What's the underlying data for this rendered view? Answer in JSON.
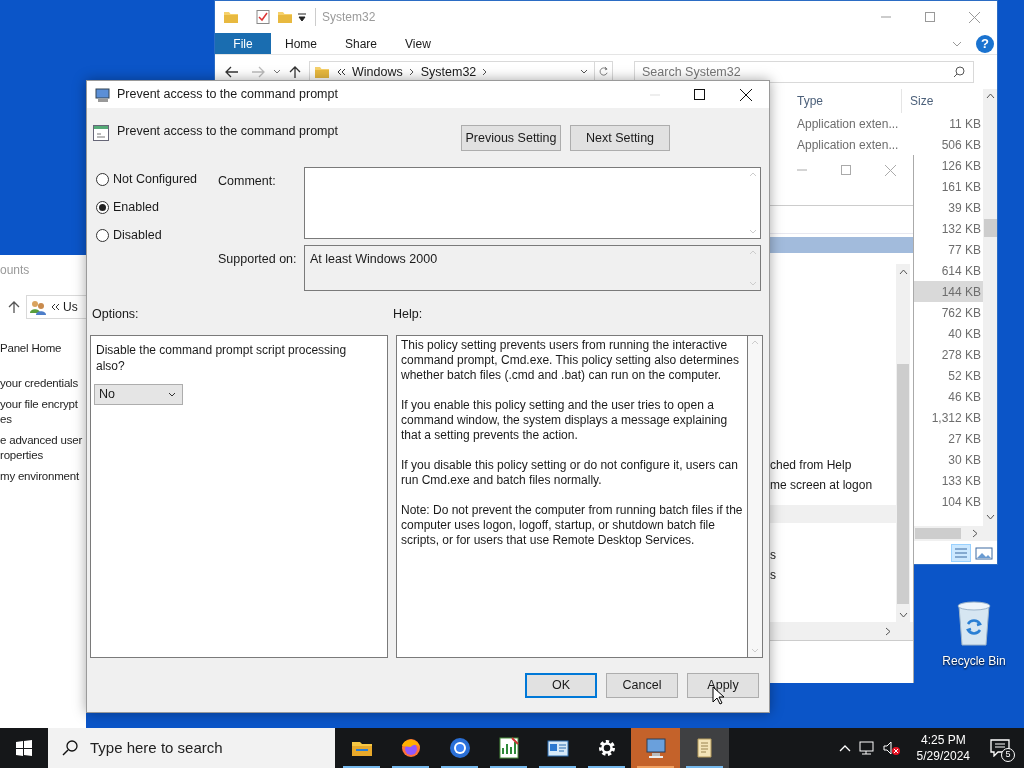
{
  "explorer": {
    "title": "System32",
    "ribbon_tabs": [
      {
        "label": "File",
        "kind": "file"
      },
      {
        "label": "Home",
        "kind": "tab"
      },
      {
        "label": "Share",
        "kind": "tab"
      },
      {
        "label": "View",
        "kind": "tab"
      }
    ],
    "help": "?",
    "address": [
      {
        "label": "Windows"
      },
      {
        "label": "System32"
      }
    ],
    "search": {
      "placeholder": "Search System32"
    },
    "columns": [
      "Type",
      "Size"
    ],
    "rows": [
      {
        "type": "Application exten...",
        "size": "11 KB",
        "selected": false
      },
      {
        "type": "Application exten...",
        "size": "506 KB",
        "selected": false
      },
      {
        "size": "126 KB",
        "selected": false
      },
      {
        "size": "161 KB",
        "selected": false
      },
      {
        "size": "39 KB",
        "selected": false
      },
      {
        "size": "132 KB",
        "selected": false
      },
      {
        "size": "77 KB",
        "selected": false
      },
      {
        "size": "614 KB",
        "selected": false
      },
      {
        "size": "144 KB",
        "selected": true
      },
      {
        "size": "762 KB",
        "selected": false
      },
      {
        "size": "40 KB",
        "selected": false
      },
      {
        "size": "278 KB",
        "selected": false
      },
      {
        "size": "52 KB",
        "selected": false
      },
      {
        "size": "46 KB",
        "selected": false
      },
      {
        "size": "1,312 KB",
        "selected": false
      },
      {
        "size": "27 KB",
        "selected": false
      },
      {
        "size": "30 KB",
        "selected": false
      },
      {
        "size": "133 KB",
        "selected": false
      },
      {
        "size": "104 KB",
        "selected": false
      }
    ]
  },
  "control_panel": {
    "title": "ounts",
    "address": "Us",
    "links": [
      "Panel Home",
      "your credentials",
      "your file encrypt\nes",
      "e advanced user\nroperties",
      "my environment"
    ]
  },
  "back_window": {
    "lines": [
      "ched from Help",
      "me screen at logon",
      "s",
      "s"
    ]
  },
  "desktop": {
    "icons": [
      {
        "label": "Recycle Bin"
      }
    ]
  },
  "dialog": {
    "title": "Prevent access to the command prompt",
    "setting": "Prevent access to the command prompt",
    "nav_buttons": [
      "Previous Setting",
      "Next Setting"
    ],
    "states": [
      {
        "label": "Not Configured",
        "selected": false
      },
      {
        "label": "Enabled",
        "selected": true
      },
      {
        "label": "Disabled",
        "selected": false
      }
    ],
    "comment_label": "Comment:",
    "supported_label": "Supported on:",
    "supported_value": "At least Windows 2000",
    "options_label": "Options:",
    "help_label": "Help:",
    "option": {
      "text": "Disable the command prompt script processing also?",
      "value": "No"
    },
    "help": [
      "This policy setting prevents users from running the interactive command prompt, Cmd.exe.  This policy setting also determines whether batch files (.cmd and .bat) can run on the computer.",
      "If you enable this policy setting and the user tries to open a command window, the system displays a message explaining that a setting prevents the action.",
      "If you disable this policy setting or do not configure it, users can run Cmd.exe and batch files normally.",
      "Note: Do not prevent the computer from running batch files if the computer uses logon, logoff, startup, or shutdown batch file scripts, or for users that use Remote Desktop Services."
    ],
    "buttons": [
      {
        "label": "OK",
        "default": true
      },
      {
        "label": "Cancel",
        "default": false
      },
      {
        "label": "Apply",
        "default": false
      }
    ]
  },
  "taskbar": {
    "search": {
      "placeholder": "Type here to search"
    },
    "apps": [
      {
        "kind": "folder",
        "active": false,
        "highlighted": false
      },
      {
        "kind": "firefox",
        "active": false,
        "highlighted": false
      },
      {
        "kind": "chrome",
        "active": false,
        "highlighted": false
      },
      {
        "kind": "chart",
        "active": false,
        "highlighted": false
      },
      {
        "kind": "card",
        "active": false,
        "highlighted": false
      },
      {
        "kind": "gear",
        "active": false,
        "highlighted": false
      },
      {
        "kind": "computer",
        "active": true,
        "highlighted": false
      },
      {
        "kind": "scroll",
        "active": false,
        "highlighted": true
      }
    ],
    "clock": {
      "time": "4:25 PM",
      "date": "5/29/2024"
    },
    "notifications": "5"
  }
}
